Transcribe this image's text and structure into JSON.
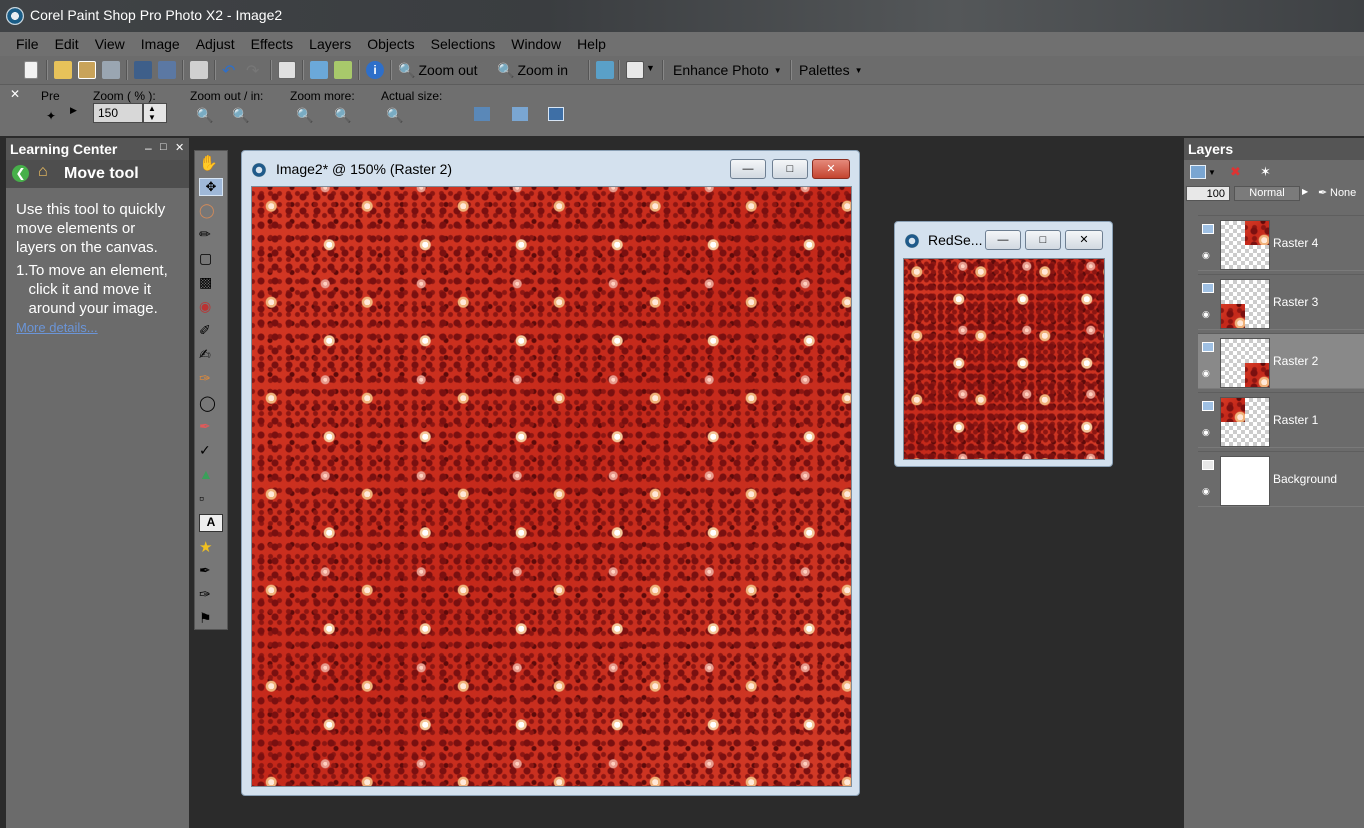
{
  "app": {
    "title": "Corel Paint Shop Pro Photo X2 - Image2"
  },
  "menu": [
    "File",
    "Edit",
    "View",
    "Image",
    "Adjust",
    "Effects",
    "Layers",
    "Objects",
    "Selections",
    "Window",
    "Help"
  ],
  "toolbar": {
    "zoom_out_label": "Zoom out",
    "zoom_in_label": "Zoom in",
    "enhance_photo_label": "Enhance Photo",
    "palettes_label": "Palettes"
  },
  "tool_options": {
    "presets_label": "Pre",
    "zoom_label": "Zoom ( % ):",
    "zoom_value": "150",
    "zoom_out_in_label": "Zoom out / in:",
    "zoom_more_label": "Zoom more:",
    "actual_size_label": "Actual size:"
  },
  "learning_center": {
    "title": "Learning Center",
    "tool_name": "Move tool",
    "intro": "Use this tool to quickly move elements or layers on the canvas.",
    "step_number": "1.",
    "step_text": "To move an element, click it and move it around your image.",
    "more_link": "More details..."
  },
  "windows": {
    "main": {
      "title": "Image2* @ 150% (Raster 2)"
    },
    "secondary": {
      "title": "RedSe..."
    }
  },
  "layers_palette": {
    "title": "Layers",
    "opacity": "100",
    "blend_mode": "Normal",
    "mask_mode": "None",
    "layers": [
      {
        "name": "Raster 4",
        "selected": false
      },
      {
        "name": "Raster 3",
        "selected": false
      },
      {
        "name": "Raster 2",
        "selected": true
      },
      {
        "name": "Raster 1",
        "selected": false
      },
      {
        "name": "Background",
        "selected": false
      }
    ]
  },
  "colors": {
    "canvas_red": "#cf2f1e",
    "workspace": "#2b2b2b",
    "panel_gray": "#6b6b6b"
  }
}
